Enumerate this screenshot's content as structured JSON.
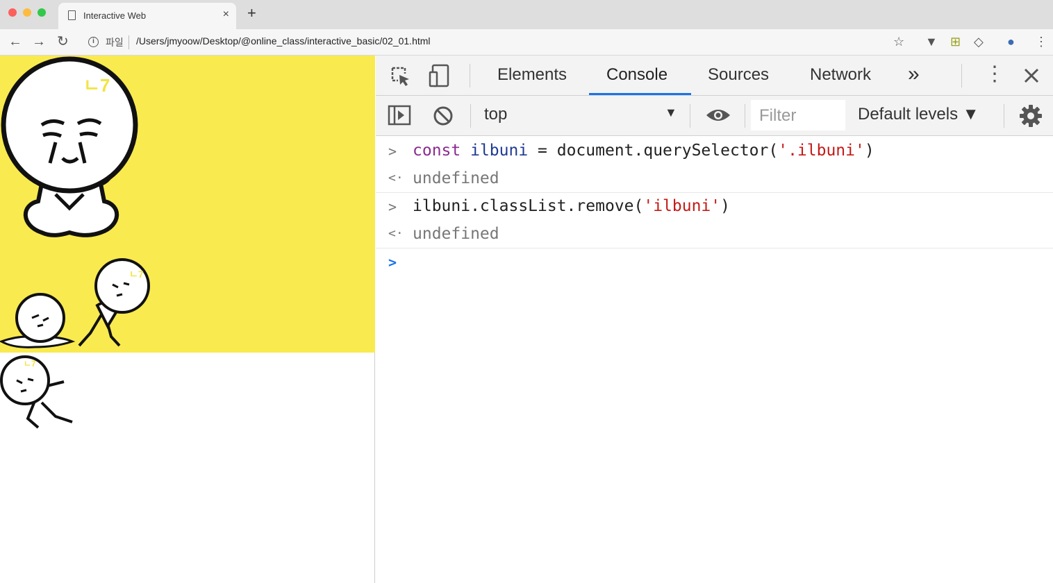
{
  "browser": {
    "tab_title": "Interactive Web",
    "tab_close": "×",
    "new_tab": "+",
    "secure_label": "파일",
    "url": "/Users/jmyoow/Desktop/@online_class/interactive_basic/02_01.html"
  },
  "page": {
    "stage_color": "#f9ea4f",
    "doodle_text": "ㄴ7"
  },
  "devtools": {
    "tabs": [
      "Elements",
      "Console",
      "Sources",
      "Network"
    ],
    "more_tabs": "»",
    "active_tab": "Console",
    "accent": "#1a73e8",
    "context": "top",
    "filter_placeholder": "Filter",
    "levels": "Default levels ▼"
  },
  "console": {
    "lines": [
      {
        "kind": "input",
        "keyword": "const ",
        "varname": "ilbuni",
        "op": " = document.querySelector(",
        "string": "'.ilbuni'",
        "close": ")"
      },
      {
        "kind": "output",
        "text": "undefined"
      },
      {
        "kind": "input",
        "code": "ilbuni.classList.remove(",
        "string": "'ilbuni'",
        "close": ")"
      },
      {
        "kind": "output",
        "text": "undefined"
      }
    ],
    "colors": {
      "keyword": "#8b2a8f",
      "variable": "#1f3a93",
      "string": "#c41a16",
      "result": "#777777",
      "prompt": "#1a73e8"
    }
  }
}
